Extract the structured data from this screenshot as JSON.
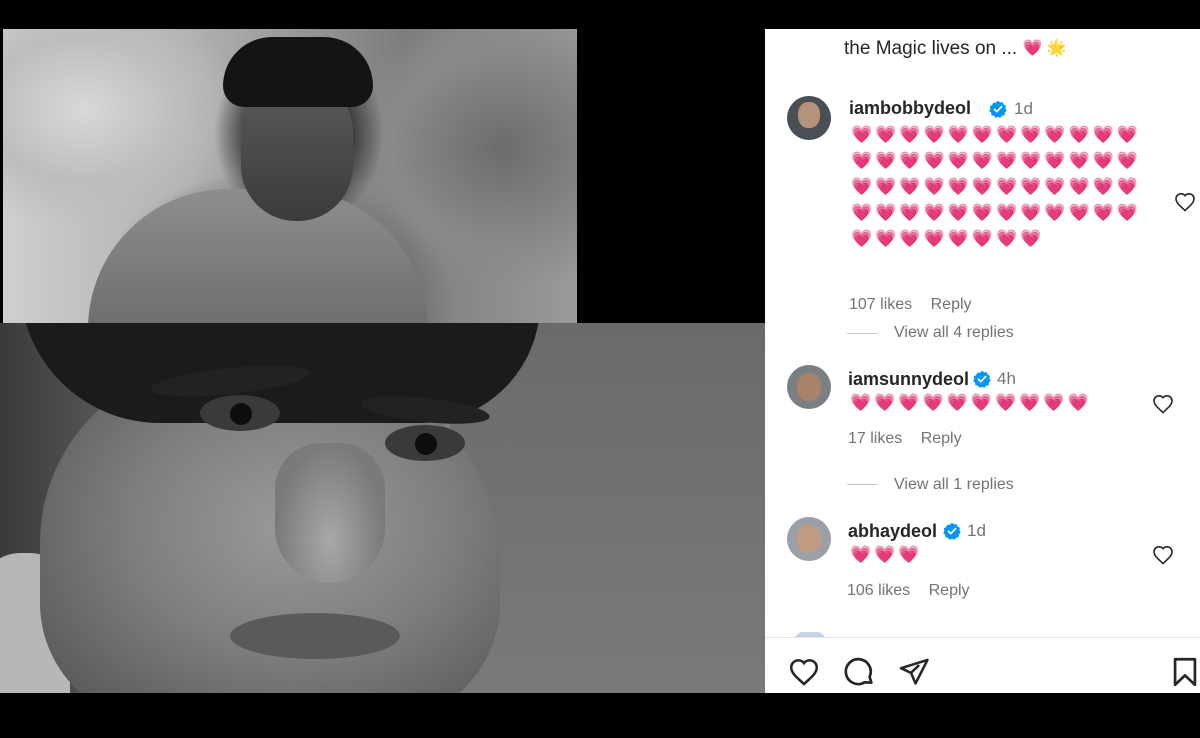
{
  "caption": {
    "text": "the Magic lives on ...",
    "emojis": "💗 🌟"
  },
  "comments": [
    {
      "username": "iambobbydeol",
      "time": "1d",
      "text": "💗💗💗💗💗💗💗💗💗💗💗💗💗💗💗💗💗💗💗💗💗💗💗💗💗💗💗💗💗💗💗💗💗💗💗💗💗💗💗💗💗💗💗💗💗💗💗💗💗💗💗💗💗💗💗💗",
      "likes": "107 likes",
      "reply": "Reply",
      "view_replies": "View all 4 replies"
    },
    {
      "username": "iamsunnydeol",
      "time": "4h",
      "text": "💗💗💗💗💗💗💗💗💗💗",
      "likes": "17 likes",
      "reply": "Reply",
      "view_replies": "View all 1 replies"
    },
    {
      "username": "abhaydeol",
      "time": "1d",
      "text": "💗💗💗",
      "likes": "106 likes",
      "reply": "Reply"
    }
  ],
  "icons": {
    "verified": "verified-badge-icon",
    "like": "heart-outline-icon",
    "comment": "comment-bubble-icon",
    "share": "paper-plane-icon",
    "save": "bookmark-icon"
  },
  "colors": {
    "verified": "#0095f6",
    "heart_emoji": "#f0466e",
    "secondary_text": "#737373"
  }
}
